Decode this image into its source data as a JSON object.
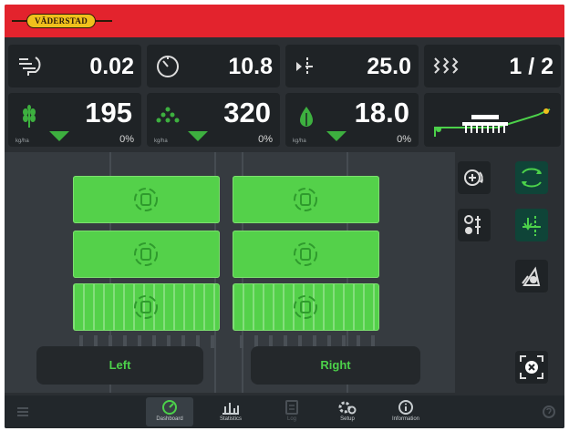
{
  "brand": {
    "logo_text": "VÄDERSTAD"
  },
  "stats_row1": [
    {
      "icon": "sowing-speed-icon",
      "value": "0.02"
    },
    {
      "icon": "speedometer-icon",
      "value": "10.8"
    },
    {
      "icon": "tramline-icon",
      "value": "25.0"
    },
    {
      "icon": "tramline-rhythm-icon",
      "value": "1 / 2"
    }
  ],
  "stats_row2": [
    {
      "icon": "wheat-icon",
      "value": "195",
      "percent": "0%",
      "unit": "kg/ha"
    },
    {
      "icon": "granules-icon",
      "value": "320",
      "percent": "0%",
      "unit": "kg/ha"
    },
    {
      "icon": "seed-drop-icon",
      "value": "18.0",
      "percent": "0%",
      "unit": "kg/ha"
    }
  ],
  "section_labels": {
    "left": "Left",
    "right": "Right"
  },
  "nav_tabs": [
    {
      "id": "dashboard",
      "label": "Dashboard",
      "icon": "dashboard-icon",
      "active": true
    },
    {
      "id": "statistics",
      "label": "Statistics",
      "icon": "statistics-icon",
      "active": false
    },
    {
      "id": "log",
      "label": "Log",
      "icon": "log-icon",
      "active": false
    },
    {
      "id": "setup",
      "label": "Setup",
      "icon": "setup-icon",
      "active": false
    },
    {
      "id": "information",
      "label": "Information",
      "icon": "information-icon",
      "active": false
    }
  ],
  "colors": {
    "accent_green": "#4cd14a",
    "header_red": "#e3232d",
    "panel_dark": "#1f2326",
    "logo_yellow": "#f0c01c"
  }
}
